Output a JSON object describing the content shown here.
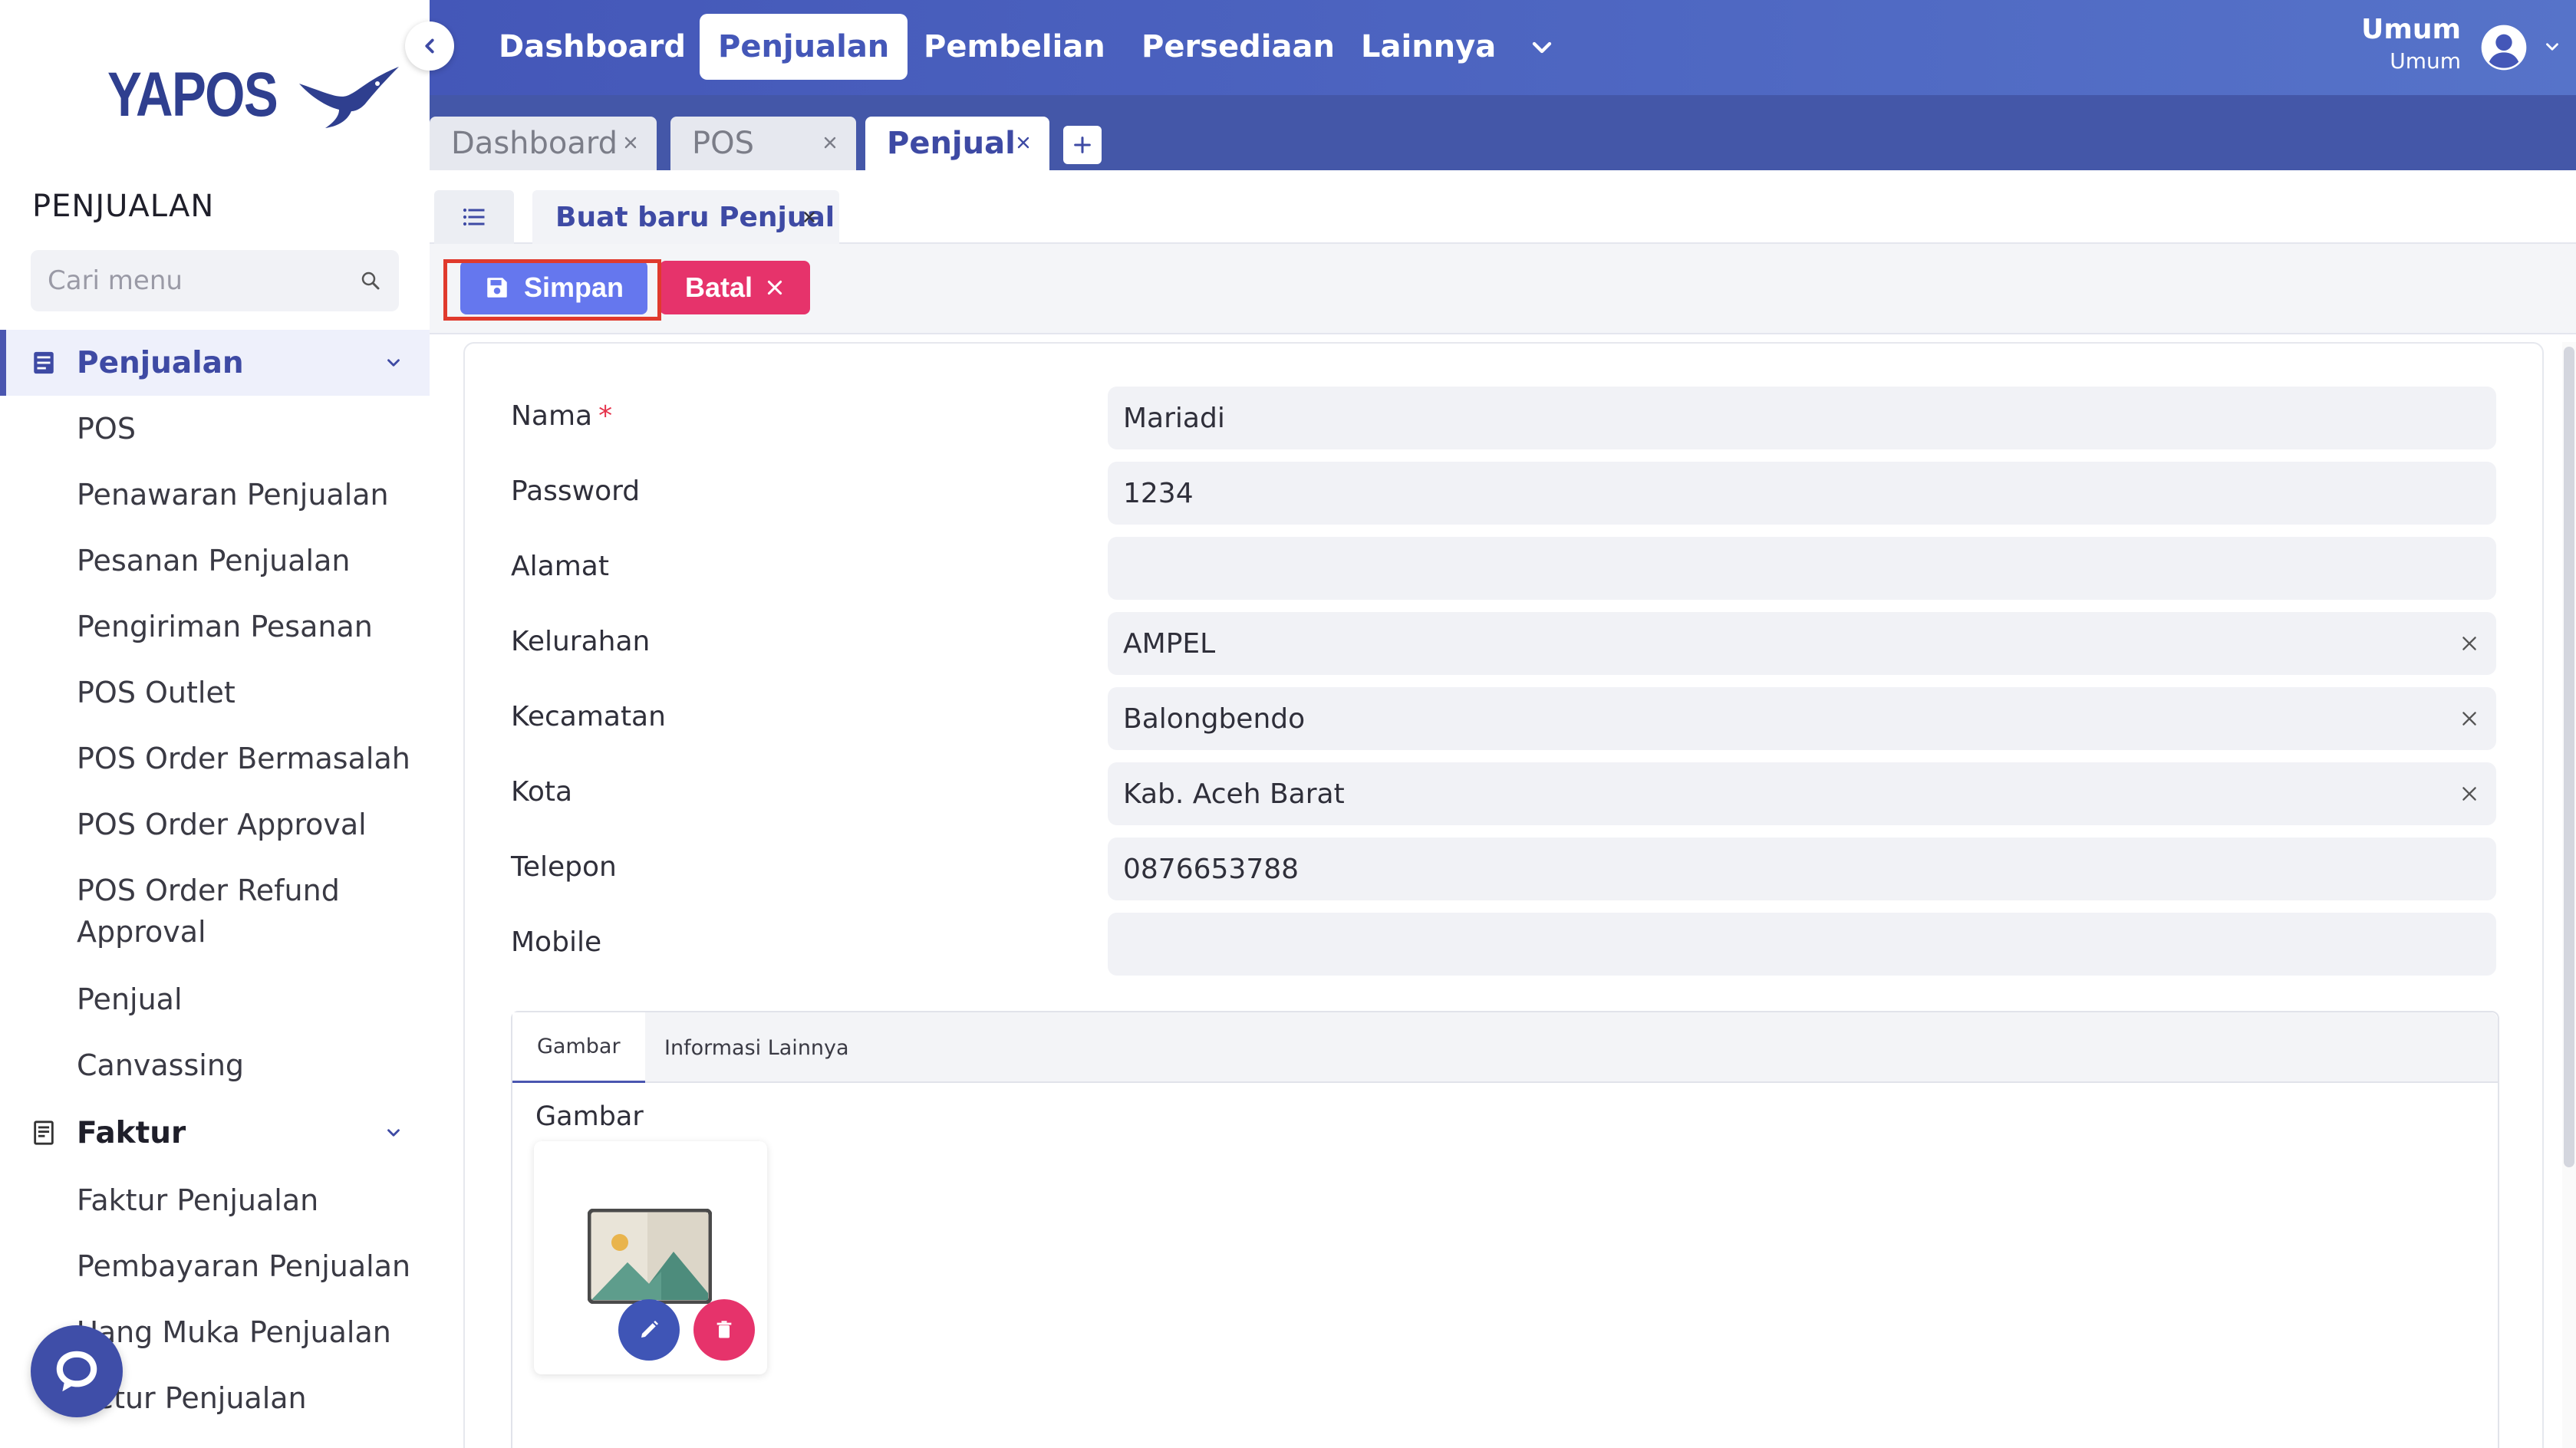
{
  "brand": {
    "name": "YAPOS"
  },
  "sidebar": {
    "section_title": "PENJUALAN",
    "search_placeholder": "Cari menu",
    "groups": [
      {
        "label": "Penjualan",
        "items": [
          "POS",
          "Penawaran Penjualan",
          "Pesanan Penjualan",
          "Pengiriman Pesanan",
          "POS Outlet",
          "POS Order Bermasalah",
          "POS Order Approval",
          "POS Order Refund",
          "Approval",
          "Penjual",
          "Canvassing"
        ]
      },
      {
        "label": "Faktur",
        "items": [
          "Faktur Penjualan",
          "Pembayaran Penjualan",
          "Uang Muka Penjualan",
          "Retur Penjualan"
        ]
      }
    ]
  },
  "topnav": {
    "items": [
      "Dashboard",
      "Penjualan",
      "Pembelian",
      "Persediaan",
      "Lainnya"
    ],
    "active": "Penjualan"
  },
  "user": {
    "name": "Umum",
    "role": "Umum"
  },
  "tabs": [
    {
      "label": "Dashboard"
    },
    {
      "label": "POS"
    },
    {
      "label": "Penjual"
    }
  ],
  "subtab": {
    "label": "Buat baru Penjual"
  },
  "toolbar": {
    "save_label": "Simpan",
    "cancel_label": "Batal"
  },
  "form": {
    "fields": [
      {
        "label": "Nama",
        "value": "Mariadi",
        "required": "*"
      },
      {
        "label": "Password",
        "value": "1234"
      },
      {
        "label": "Alamat",
        "value": ""
      },
      {
        "label": "Kelurahan",
        "value": "AMPEL"
      },
      {
        "label": "Kecamatan",
        "value": "Balongbendo"
      },
      {
        "label": "Kota",
        "value": "Kab. Aceh Barat"
      },
      {
        "label": "Telepon",
        "value": "0876653788"
      },
      {
        "label": "Mobile",
        "value": ""
      }
    ]
  },
  "panel": {
    "tabs": [
      "Gambar",
      "Informasi Lainnya"
    ],
    "image_label": "Gambar"
  },
  "colors": {
    "accent": "#4457b8",
    "save": "#6577ee",
    "cancel": "#e6336b",
    "highlight": "#e03a2d"
  }
}
